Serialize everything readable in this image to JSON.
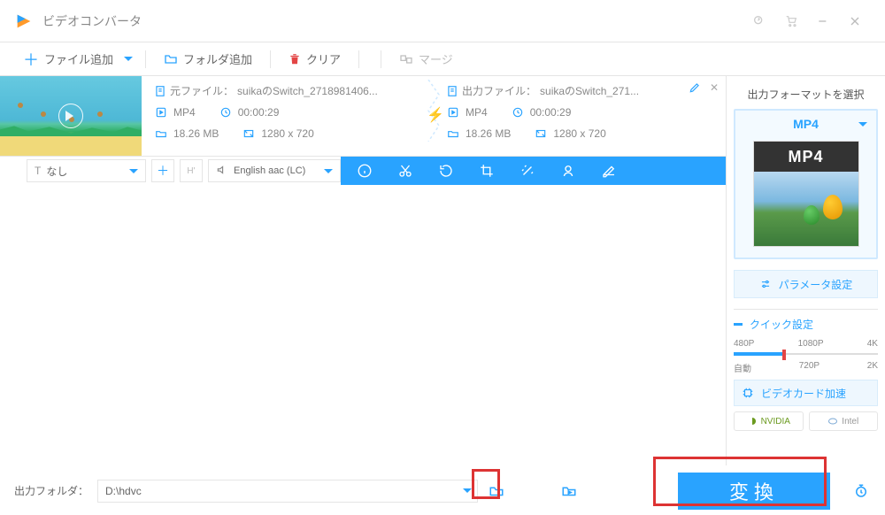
{
  "app": {
    "title": "ビデオコンバータ"
  },
  "toolbar": {
    "add_file": "ファイル追加",
    "add_folder": "フォルダ追加",
    "clear": "クリア",
    "merge": "マージ"
  },
  "item": {
    "source": {
      "label_prefix": "元ファイル：",
      "filename": "suikaのSwitch_2718981406...",
      "format": "MP4",
      "duration": "00:00:29",
      "size": "18.26 MB",
      "resolution": "1280 x 720"
    },
    "output": {
      "label_prefix": "出力ファイル：",
      "filename": "suikaのSwitch_271...",
      "format": "MP4",
      "duration": "00:00:29",
      "size": "18.26 MB",
      "resolution": "1280 x 720"
    }
  },
  "controls": {
    "subtitle_none": "なし",
    "audio_track": "English aac (LC)"
  },
  "right_panel": {
    "title": "出力フォーマットを選択",
    "format": "MP4",
    "icon_text": "MP4",
    "param_btn": "パラメータ設定",
    "quick_title": "クイック設定",
    "ticks_top": [
      "480P",
      "1080P",
      "4K"
    ],
    "ticks_bottom": [
      "自動",
      "720P",
      "2K"
    ],
    "gpu_label": "ビデオカード加速",
    "chip1": "NVIDIA",
    "chip2": "Intel"
  },
  "bottom": {
    "out_label": "出力フォルダ：",
    "path": "D:\\hdvc",
    "convert": "変換"
  }
}
